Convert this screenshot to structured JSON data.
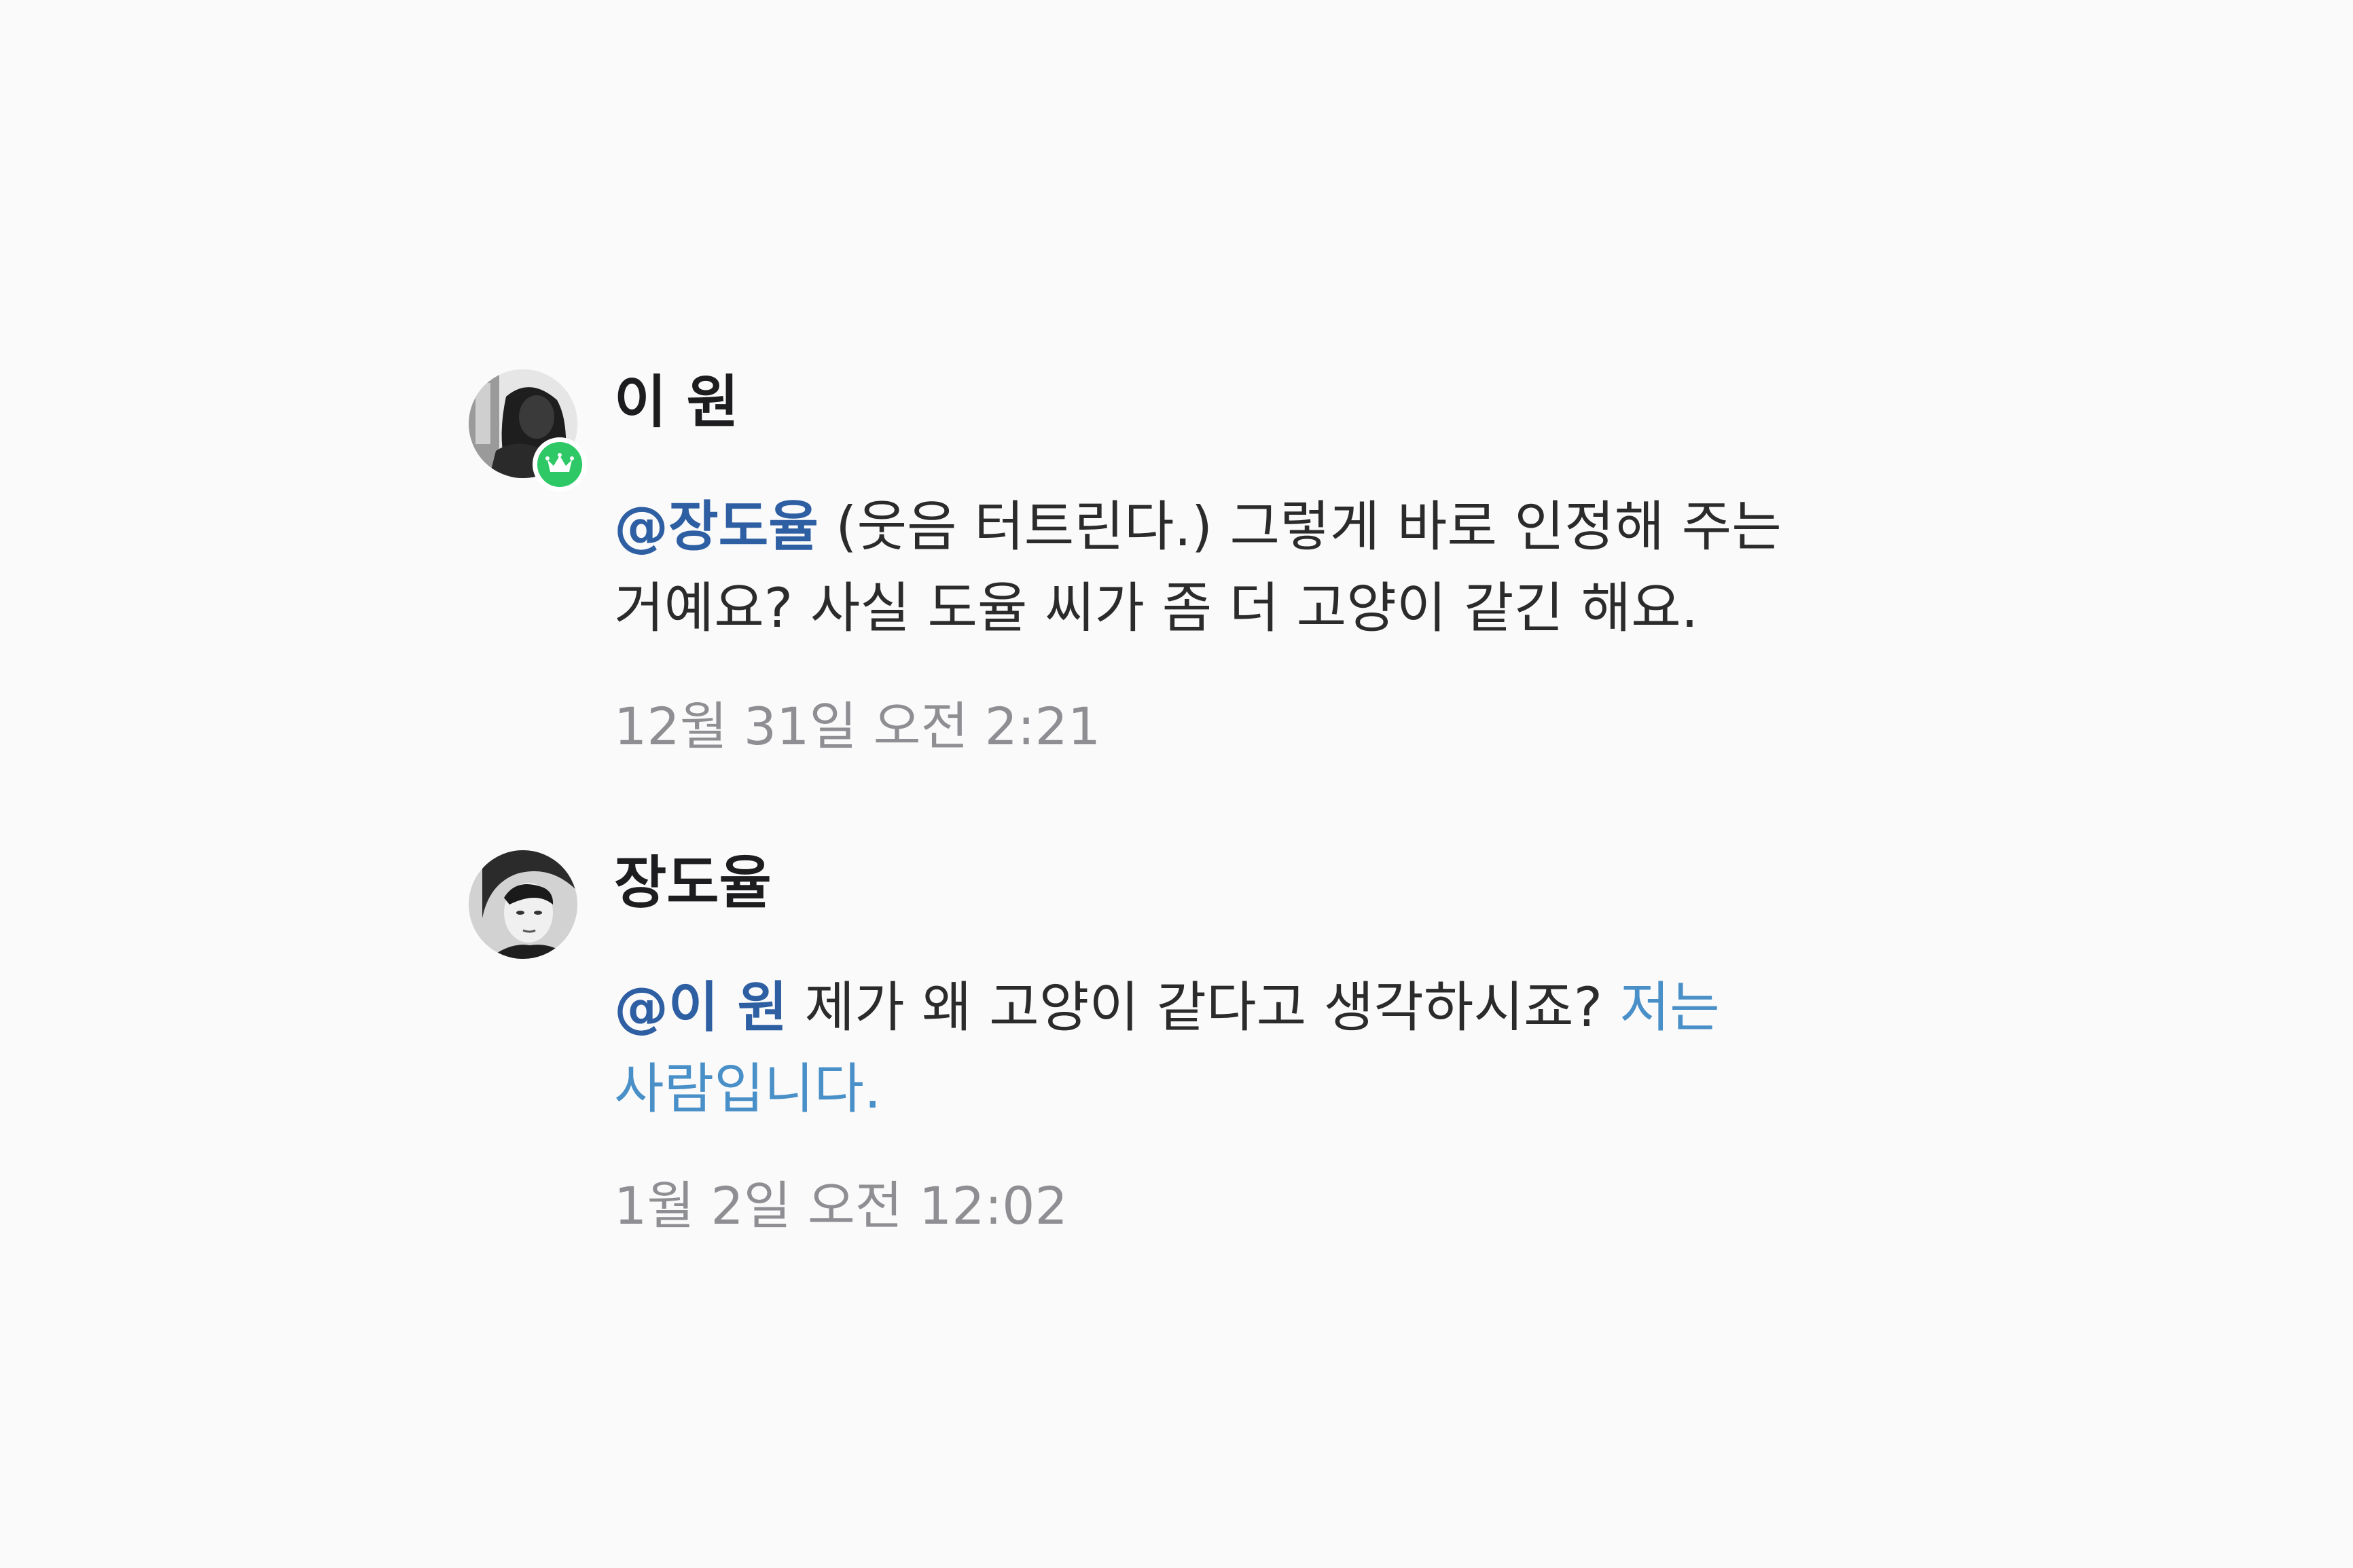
{
  "comments": [
    {
      "author": "이 원",
      "badge_icon": "crown-icon",
      "mention": "@장도율",
      "text": " (웃음 터트린다.) 그렇게 바로 인정해 주는 거예요? 사실 도율 씨가 좀 더 고양이 같긴 해요.",
      "link_text": "",
      "timestamp": "12월 31일 오전 2:21"
    },
    {
      "author": "장도율",
      "mention": "@이 원",
      "text": " 제가 왜 고양이 같다고 생각하시죠? ",
      "link_text": "저는 사람입니다.",
      "timestamp": "1월 2일 오전 12:02"
    }
  ],
  "colors": {
    "background": "#fafafa",
    "mention": "#2e5fa3",
    "link": "#4a90c8",
    "badge": "#2ec866",
    "timestamp": "#8e8e93"
  }
}
